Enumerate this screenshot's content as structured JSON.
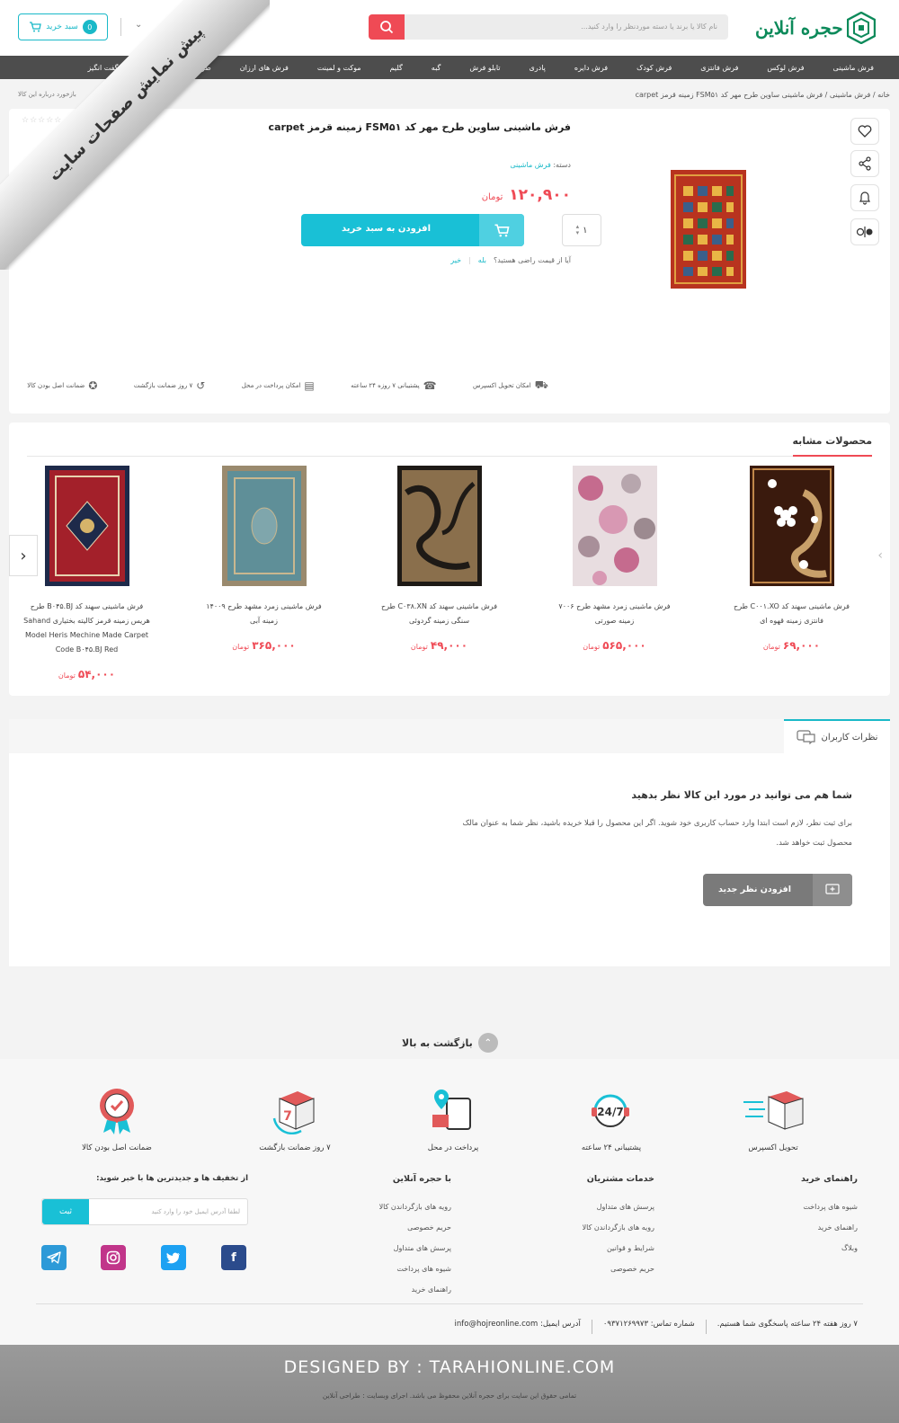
{
  "header": {
    "logo_text": "حجره آنلاین",
    "search_placeholder": "نام کالا یا برند یا دسته موردنظر را وارد کنید...",
    "cart_label": "سبد خرید",
    "cart_count": "0"
  },
  "nav": [
    "فرش ماشینی",
    "فرش لوکس",
    "فرش فانتزی",
    "فرش کودک",
    "فرش دایره",
    "پادری",
    "تابلو فرش",
    "گبه",
    "گلیم",
    "موکت و لمینت",
    "فرش های ارزان",
    "طراحی",
    "پیشنهادهای شگفت انگیز"
  ],
  "breadcrumb": "خانه / فرش ماشینی / فرش ماشینی ساوین طرح مهر کد FSM۵۱ زمینه قرمز carpet",
  "breadcrumb_left": "بازخورد درباره این کالا",
  "ribbon": "پیش نمایش صفحات سایت",
  "product": {
    "title": "فرش ماشینی ساوین طرح مهر کد FSM۵۱ زمینه قرمز carpet",
    "category_label": "دسته:",
    "category": "فرش ماشینی",
    "price": "۱۲۰,۹۰۰",
    "currency": "تومان",
    "qty": "۱",
    "add_to_cart": "افزودن به سبد خرید",
    "question": "آیا از قیمت راضی هستید؟",
    "yes": "بله",
    "no": "خیر",
    "stars": "☆☆☆☆☆"
  },
  "features": [
    {
      "label": "امکان تحویل اکسپرس",
      "icon": "truck-icon"
    },
    {
      "label": "پشتیبانی ۷ روزه ۲۴ ساعته",
      "icon": "support-icon"
    },
    {
      "label": "امکان پرداخت در محل",
      "icon": "cash-icon"
    },
    {
      "label": "۷ روز ضمانت بازگشت",
      "icon": "return-icon"
    },
    {
      "label": "ضمانت اصل بودن کالا",
      "icon": "badge-icon"
    }
  ],
  "similar": {
    "title": "محصولات مشابه",
    "items": [
      {
        "name": "فرش ماشینی سهند کد C۰۰۱.XO طرح فانتزی زمینه قهوه ای",
        "price": "۶۹,۰۰۰",
        "currency": "تومان"
      },
      {
        "name": "فرش ماشینی زمرد مشهد طرح ۷۰۰۶ زمینه صورتی",
        "price": "۵۶۵,۰۰۰",
        "currency": "تومان"
      },
      {
        "name": "فرش ماشینی سهند کد C۰۳۸.XN طرح سنگی زمینه گردوئی",
        "price": "۴۹,۰۰۰",
        "currency": "تومان"
      },
      {
        "name": "فرش ماشینی زمرد مشهد طرح ۱۴۰۰۹ زمینه آبی",
        "price": "۳۶۵,۰۰۰",
        "currency": "تومان"
      },
      {
        "name": "فرش ماشینی سهند کد B۰۴۵.BJ طرح هریس زمینه قرمز کالیته بختیاری Sahand Model Heris Mechine Made Carpet Code B۰۴۵.BJ Red",
        "price": "۵۴,۰۰۰",
        "currency": "تومان"
      }
    ]
  },
  "comments": {
    "tab": "نظرات کاربران",
    "heading": "شما هم می توانید در مورد این کالا نظر بدهید",
    "desc": "برای ثبت نظر، لازم است ابتدا وارد حساب کاربری خود شوید. اگر این محصول را قبلا خریده باشید، نظر شما به عنوان مالک محصول ثبت خواهد شد.",
    "button": "افزودن نظر جدید"
  },
  "back_to_top": "بازگشت به بالا",
  "footer": {
    "features": [
      "تحویل اکسپرس",
      "پشتیبانی ۲۴ ساعته",
      "پرداخت در محل",
      "۷ روز ضمانت بازگشت",
      "ضمانت اصل بودن کالا"
    ],
    "col1": {
      "title": "راهنمای خرید",
      "links": [
        "شیوه های پرداخت",
        "راهنمای خرید",
        "وبلاگ"
      ]
    },
    "col2": {
      "title": "خدمات مشتریان",
      "links": [
        "پرسش های متداول",
        "رویه های بازگرداندن کالا",
        "شرایط و قوانین",
        "حریم خصوصی"
      ]
    },
    "col3": {
      "title": "با حجره آنلاین",
      "links": [
        "رویه های بازگرداندن کالا",
        "حریم خصوصی",
        "پرسش های متداول",
        "شیوه های پرداخت",
        "راهنمای خرید"
      ]
    },
    "newsletter_title": "از تخفیف ها و جدیدترین ها با خبر شوید:",
    "newsletter_placeholder": "لطفا آدرس ایمیل خود را وارد کنید",
    "newsletter_button": "ثبت",
    "hours": "۷ روز هفته ۲۴ ساعته پاسخگوی شما هستیم.",
    "phone": "شماره تماس: ۰۹۳۷۱۲۶۹۹۷۳",
    "email": "آدرس ایمیل: info@hojreonline.com",
    "designed_by": "DESIGNED BY :  TARAHIONLINE.COM",
    "copyright": "تمامی حقوق این سایت برای  حجره آنلاین محفوظ می باشد. اجرای وبسایت :  طراحی آنلاین"
  },
  "colors": {
    "accent": "#19c0d6",
    "price": "#ef4a55",
    "nav": "#4d4d4d",
    "brand": "#0c8a5a"
  }
}
